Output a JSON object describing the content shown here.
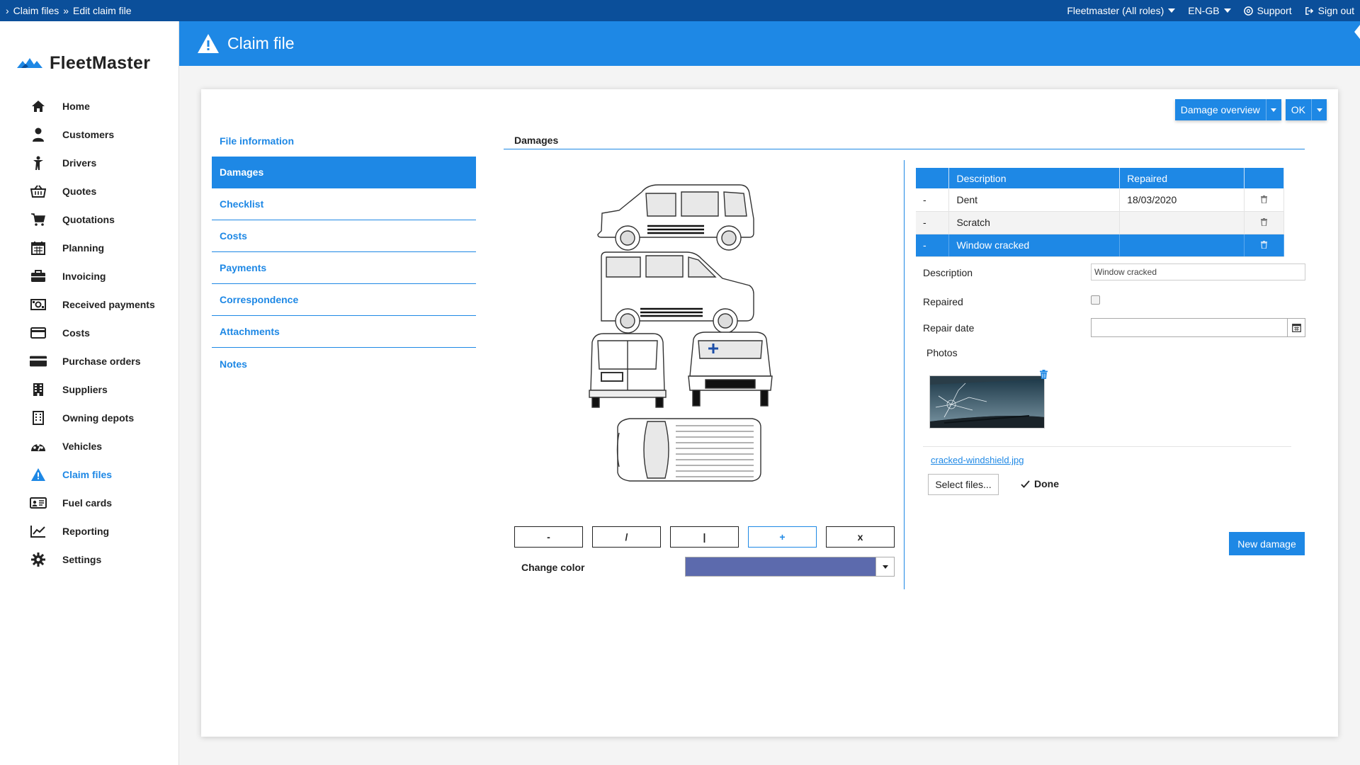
{
  "breadcrumb": {
    "items": [
      "Claim files",
      "Edit claim file"
    ]
  },
  "topbar": {
    "role": "Fleetmaster (All roles)",
    "language": "EN-GB",
    "support": "Support",
    "signout": "Sign out"
  },
  "app": {
    "name": "FleetMaster"
  },
  "sidebar": {
    "items": [
      {
        "label": "Home",
        "icon": "home-icon"
      },
      {
        "label": "Customers",
        "icon": "user-icon"
      },
      {
        "label": "Drivers",
        "icon": "driver-icon"
      },
      {
        "label": "Quotes",
        "icon": "basket-icon"
      },
      {
        "label": "Quotations",
        "icon": "cart-icon"
      },
      {
        "label": "Planning",
        "icon": "calendar-icon"
      },
      {
        "label": "Invoicing",
        "icon": "briefcase-icon"
      },
      {
        "label": "Received payments",
        "icon": "money-icon"
      },
      {
        "label": "Costs",
        "icon": "credit-card-icon"
      },
      {
        "label": "Purchase orders",
        "icon": "card-icon"
      },
      {
        "label": "Suppliers",
        "icon": "building-icon"
      },
      {
        "label": "Owning depots",
        "icon": "depot-icon"
      },
      {
        "label": "Vehicles",
        "icon": "dashboard-icon"
      },
      {
        "label": "Claim files",
        "icon": "warning-icon"
      },
      {
        "label": "Fuel cards",
        "icon": "id-card-icon"
      },
      {
        "label": "Reporting",
        "icon": "chart-icon"
      },
      {
        "label": "Settings",
        "icon": "gear-icon"
      }
    ],
    "active": "Claim files"
  },
  "header": {
    "title": "Claim file"
  },
  "actions": {
    "overview": "Damage overview",
    "ok": "OK"
  },
  "subnav": {
    "items": [
      "File information",
      "Damages",
      "Checklist",
      "Costs",
      "Payments",
      "Correspondence",
      "Attachments",
      "Notes"
    ],
    "active": "Damages"
  },
  "damages": {
    "title": "Damages",
    "tools": [
      "-",
      "/",
      "|",
      "+",
      "x"
    ],
    "change_color_label": "Change color",
    "selected_color": "#5c6aad",
    "table": {
      "headers": [
        "",
        "Description",
        "Repaired",
        ""
      ],
      "rows": [
        {
          "marker": "-",
          "description": "Dent",
          "repaired": "18/03/2020"
        },
        {
          "marker": "-",
          "description": "Scratch",
          "repaired": ""
        },
        {
          "marker": "-",
          "description": "Window cracked",
          "repaired": ""
        }
      ],
      "selected_row": 2
    },
    "form": {
      "description_label": "Description",
      "description_value": "Window cracked",
      "repaired_label": "Repaired",
      "repair_date_label": "Repair date",
      "photos_label": "Photos",
      "file_name": "cracked-windshield.jpg",
      "select_files": "Select files...",
      "done": "Done"
    },
    "new_damage": "New damage"
  },
  "colors": {
    "primary": "#1e88e5",
    "topbar": "#0b4f9a"
  }
}
